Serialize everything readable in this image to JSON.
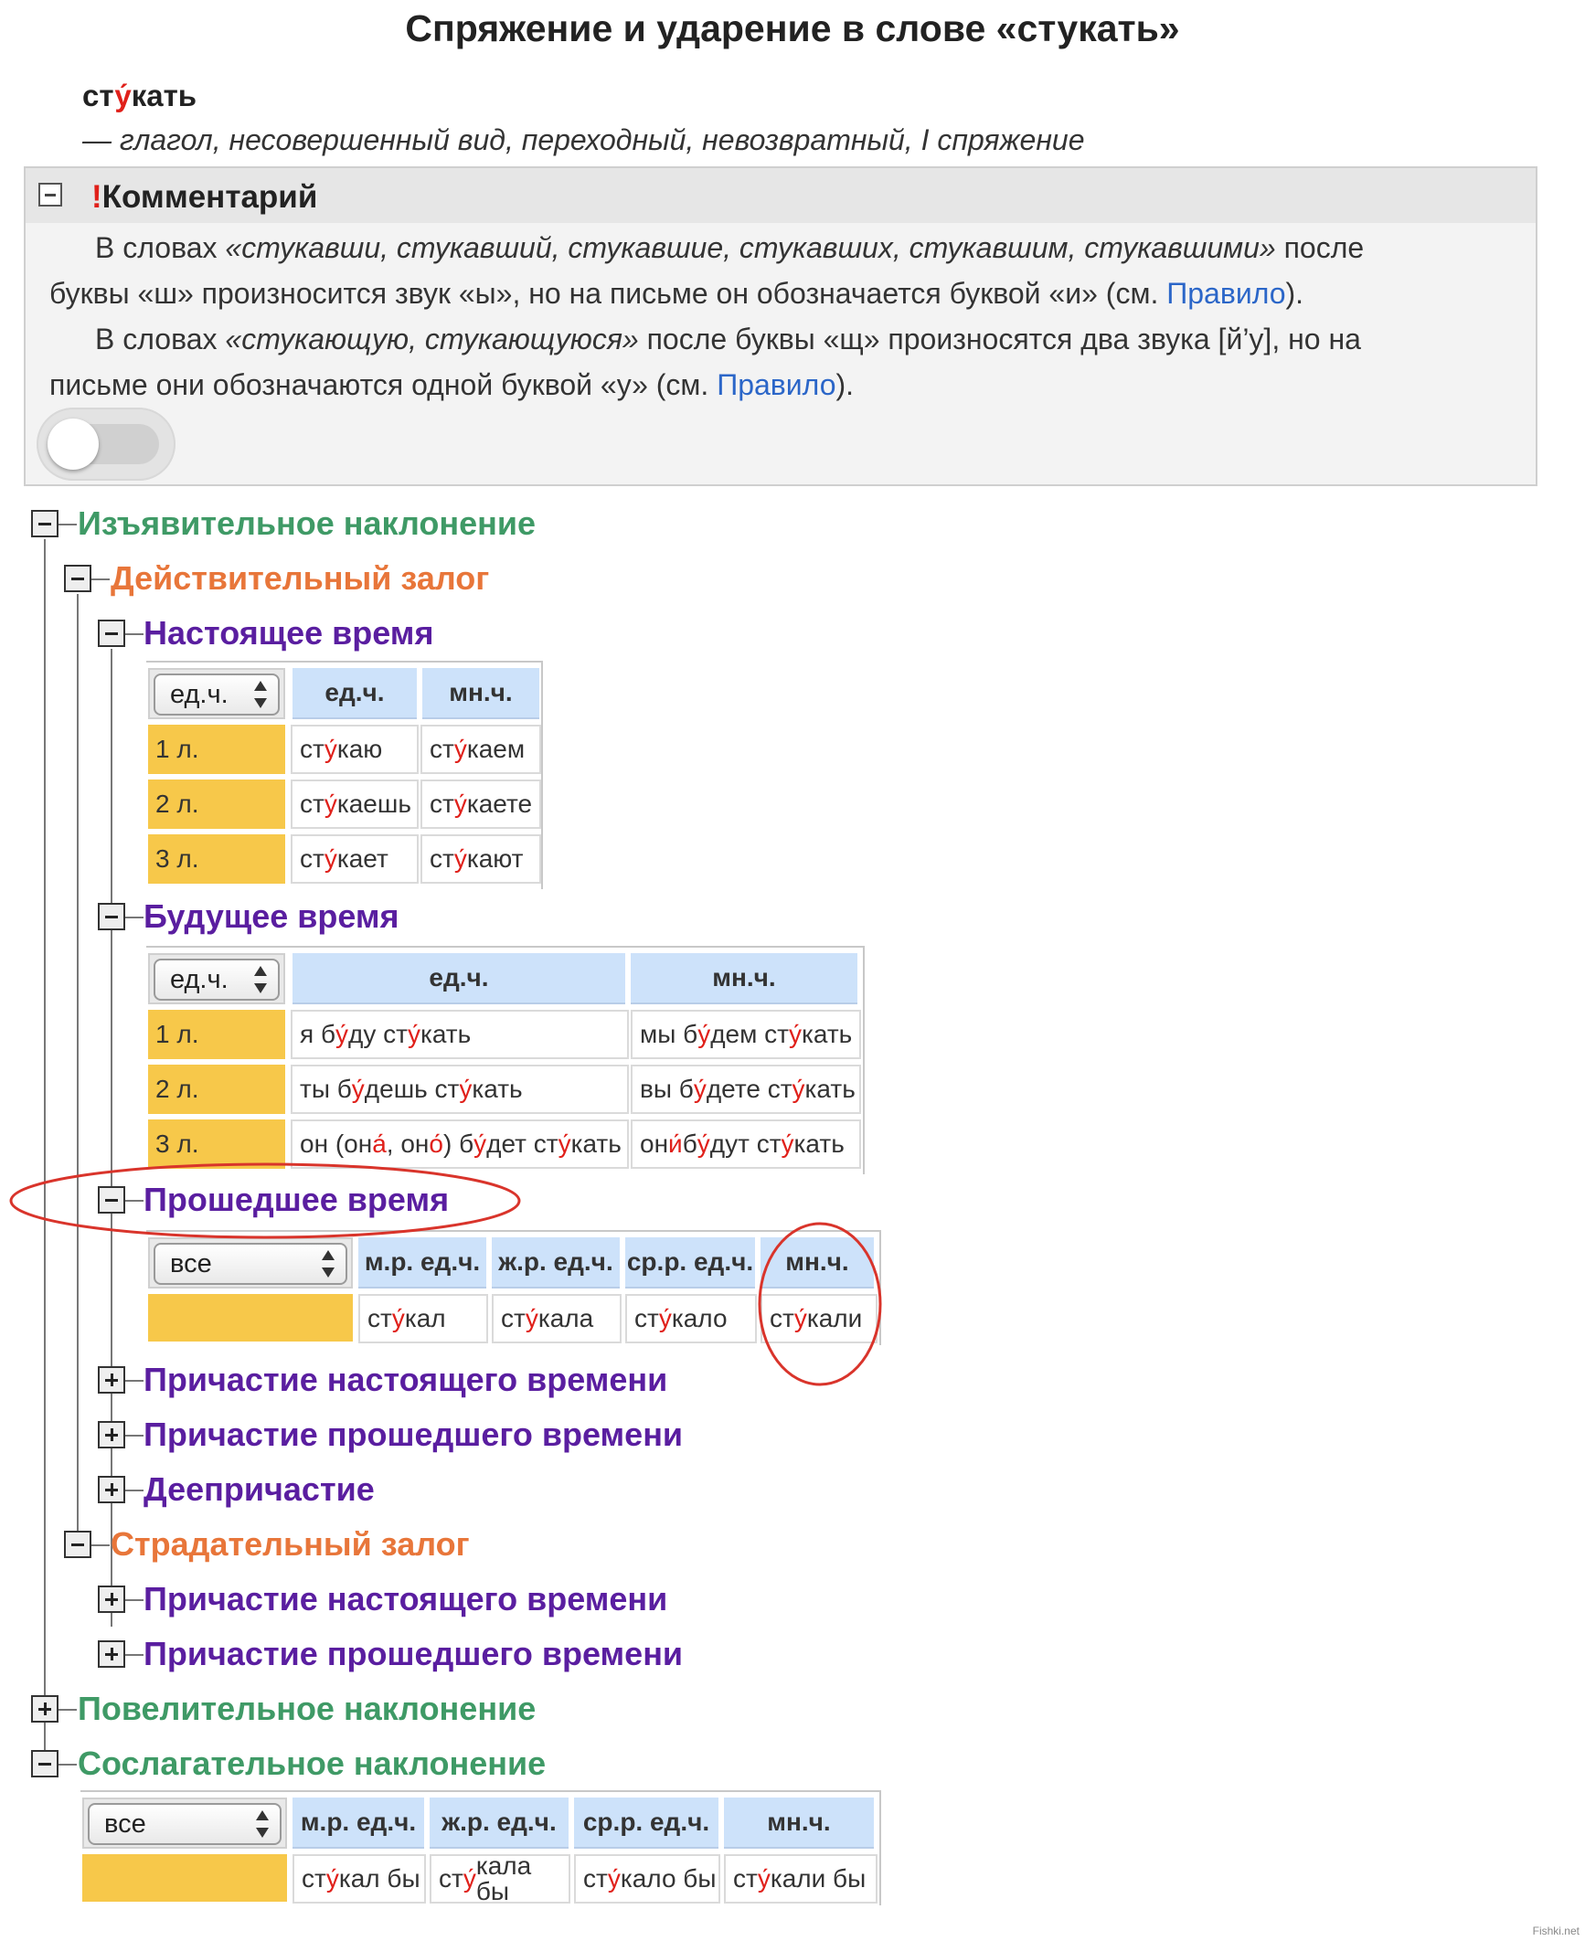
{
  "page": {
    "title": "Спряжение и ударение в слове «стукать»",
    "word_pre": "ст",
    "word_stress": "у́",
    "word_post": "кать",
    "grammar": "— глагол, несовершенный вид, переходный, невозвратный, I спряжение"
  },
  "comment": {
    "excl": "!",
    "title": "Комментарий",
    "p1_a": "В словах ",
    "p1_words_l1": "«стукавши, стукавший, стукавшие, стукавших, стукавшим, стукавшими»",
    "p1_b": " после",
    "p1_l2": "буквы «ш» произносится звук «ы», но на письме он обозначается буквой «и» (см. ",
    "p1_link": "Правило",
    "p1_end": ").",
    "p2_a": "В словах ",
    "p2_words": "«стукающую, стукающуюся»",
    "p2_b": " после буквы «щ» произносятся два звука [й’у], но на",
    "p2_l2": "письме они обозначаются одной буквой «у» (см. ",
    "p2_link": "Правило",
    "p2_end": ")."
  },
  "tree": {
    "indicative": "Изъявительное наклонение",
    "active": "Действительный залог",
    "present": "Настоящее время",
    "future": "Будущее время",
    "past": "Прошедшее время",
    "pres_participle": "Причастие настоящего времени",
    "past_participle": "Причастие прошедшего времени",
    "gerund": "Деепричастие",
    "passive": "Страдательный залог",
    "passive_pres_participle": "Причастие настоящего времени",
    "passive_past_participle": "Причастие прошедшего времени",
    "imperative": "Повелительное наклонение",
    "subjunctive": "Сослагательное наклонение"
  },
  "present_table": {
    "select": "ед.ч.",
    "headers": [
      "ед.ч.",
      "мн.ч."
    ],
    "rows": [
      {
        "person": "1 л.",
        "sg": [
          "ст",
          "у́",
          "каю"
        ],
        "pl": [
          "ст",
          "у́",
          "каем"
        ]
      },
      {
        "person": "2 л.",
        "sg": [
          "ст",
          "у́",
          "каешь"
        ],
        "pl": [
          "ст",
          "у́",
          "каете"
        ]
      },
      {
        "person": "3 л.",
        "sg": [
          "ст",
          "у́",
          "кает"
        ],
        "pl": [
          "ст",
          "у́",
          "кают"
        ]
      }
    ]
  },
  "future_table": {
    "select": "ед.ч.",
    "headers": [
      "ед.ч.",
      "мн.ч."
    ],
    "rows": [
      {
        "person": "1 л.",
        "sg": "я бу́ду сту́кать",
        "pl": "мы бу́дем сту́кать"
      },
      {
        "person": "2 л.",
        "sg": "ты бу́дешь сту́кать",
        "pl": "вы бу́дете сту́кать"
      },
      {
        "person": "3 л.",
        "sg": "он (она́, оно́) бу́дет сту́кать",
        "pl": "они́ бу́дут сту́кать"
      }
    ]
  },
  "past_table": {
    "select": "все",
    "headers": [
      "м.р. ед.ч.",
      "ж.р. ед.ч.",
      "ср.р. ед.ч.",
      "мн.ч."
    ],
    "values": [
      "сту́кал",
      "сту́кала",
      "сту́кало",
      "сту́кали"
    ]
  },
  "subj_table": {
    "select": "все",
    "headers": [
      "м.р. ед.ч.",
      "ж.р. ед.ч.",
      "ср.р. ед.ч.",
      "мн.ч."
    ],
    "values": [
      "сту́кал бы",
      "сту́кала бы",
      "сту́кало бы",
      "сту́кали бы"
    ]
  },
  "watermark": "Fishki.net",
  "colors": {
    "mood": "#3f9a66",
    "voice": "#e8763a",
    "tense": "#5a1ea0",
    "stress": "#e0201a",
    "annotation": "#d9342b"
  }
}
